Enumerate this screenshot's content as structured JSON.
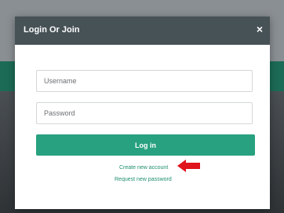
{
  "modal": {
    "title": "Login Or Join",
    "close_symbol": "×"
  },
  "form": {
    "username_placeholder": "Username",
    "password_placeholder": "Password",
    "login_label": "Log in"
  },
  "links": {
    "create_account": "Create new account",
    "request_password": "Request new password"
  },
  "icons": {
    "close": "close-icon",
    "arrow": "red-arrow-icon"
  },
  "colors": {
    "header": "#475257",
    "accent": "#27a17f",
    "link": "#1f8f6f",
    "arrow": "#e0141c"
  }
}
